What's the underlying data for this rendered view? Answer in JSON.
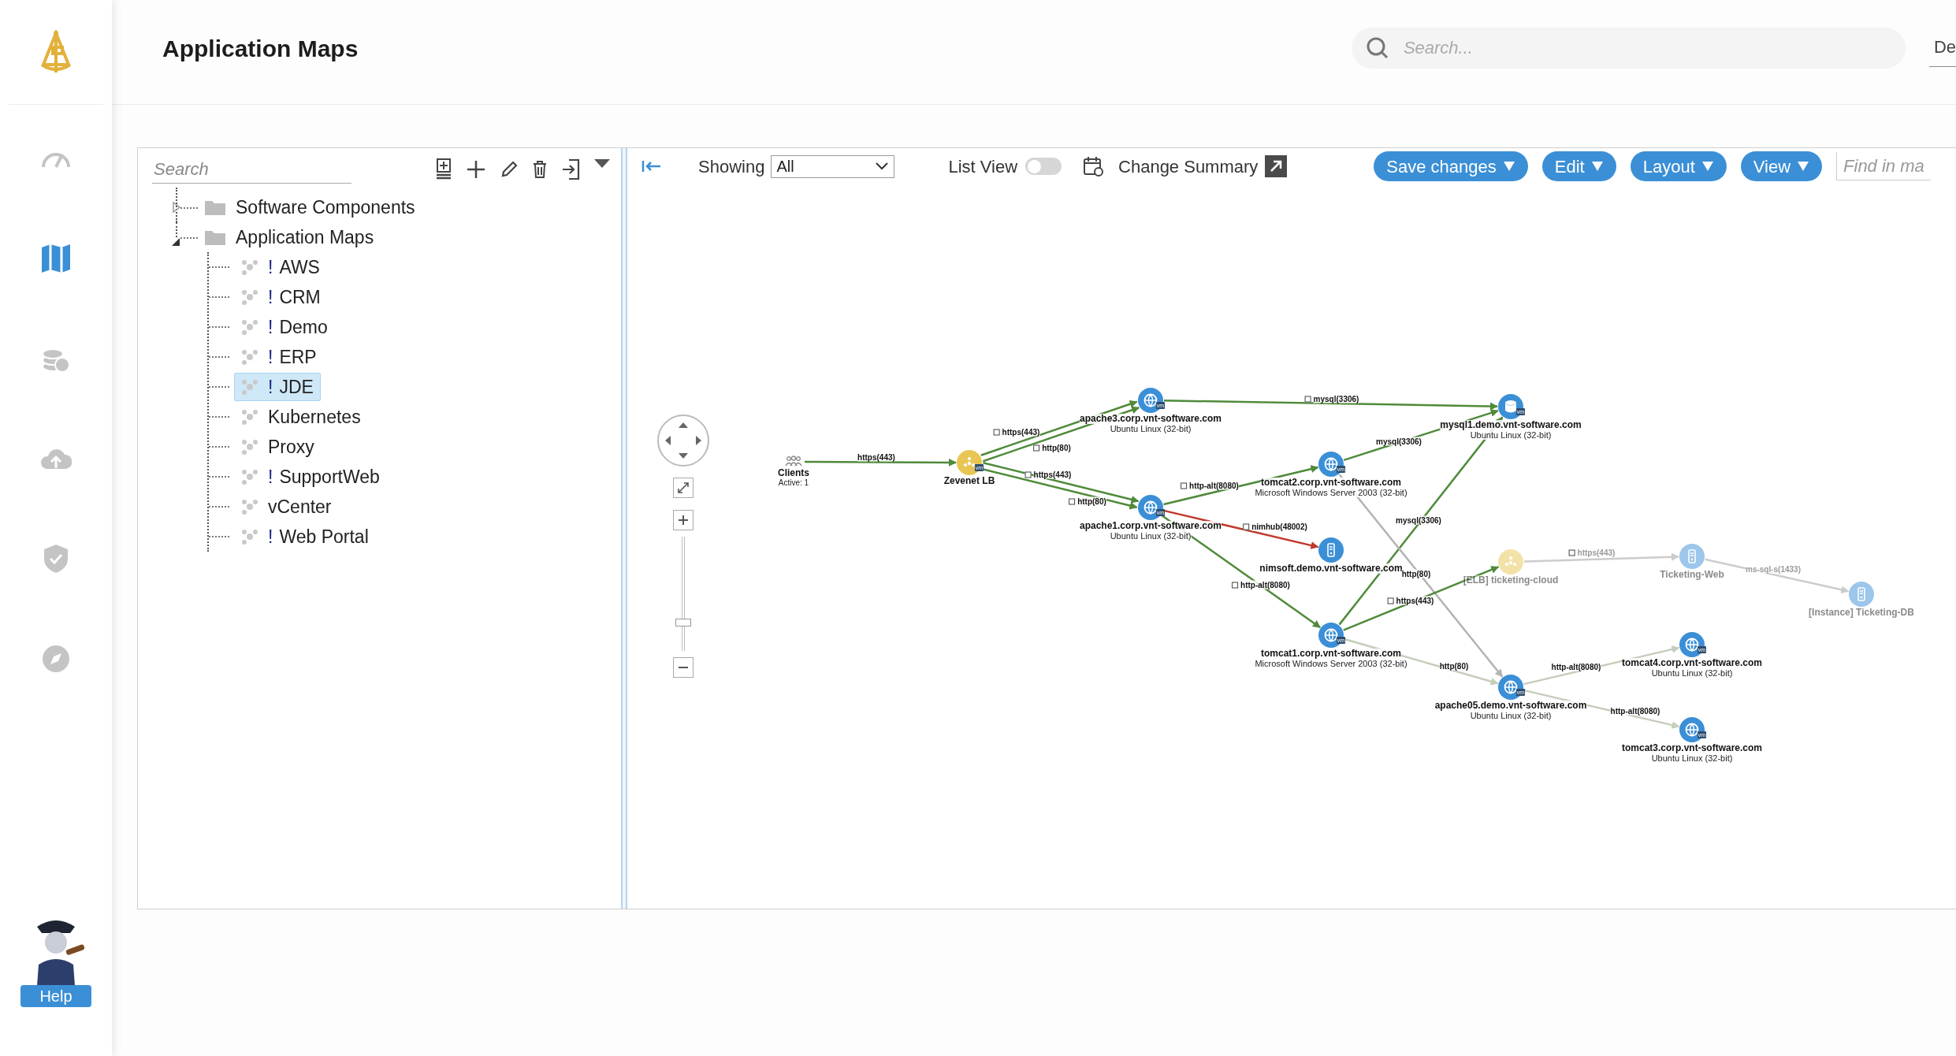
{
  "sidebar": {
    "items": [
      {
        "kind": "gauge",
        "selected": false
      },
      {
        "kind": "map",
        "selected": true
      },
      {
        "kind": "coins",
        "selected": false
      },
      {
        "kind": "cloud-upload",
        "selected": false
      },
      {
        "kind": "shield",
        "selected": false
      },
      {
        "kind": "compass",
        "selected": false
      }
    ],
    "help": "Help"
  },
  "header": {
    "title": "Application Maps",
    "search": {
      "placeholder": "Search..."
    },
    "menu": "De"
  },
  "tree_panel": {
    "search": {
      "placeholder": "Search"
    },
    "tree": [
      {
        "label": "Software Components",
        "expanded": false,
        "selected": false
      },
      {
        "label": "Application Maps",
        "expanded": true,
        "selected": false,
        "children": [
          {
            "marker": "!",
            "label": "AWS",
            "selected": false
          },
          {
            "marker": "!",
            "label": "CRM",
            "selected": false
          },
          {
            "marker": "!",
            "label": "Demo",
            "selected": false
          },
          {
            "marker": "!",
            "label": "ERP",
            "selected": false
          },
          {
            "marker": "!",
            "label": "JDE",
            "selected": true
          },
          {
            "label": "Kubernetes",
            "selected": false
          },
          {
            "label": "Proxy",
            "selected": false
          },
          {
            "marker": "!",
            "label": "SupportWeb",
            "selected": false
          },
          {
            "label": "vCenter",
            "selected": false
          },
          {
            "marker": "!",
            "label": "Web Portal",
            "selected": false
          }
        ]
      }
    ]
  },
  "map_toolbar": {
    "showing": {
      "label": "Showing",
      "value": "All"
    },
    "list_view": {
      "label": "List View",
      "on": false
    },
    "change_summary": "Change Summary",
    "buttons": [
      "Save changes",
      "Edit",
      "Layout",
      "View"
    ],
    "find": {
      "placeholder": "Find in ma"
    }
  },
  "map": {
    "zoom": {
      "level": 0.25
    },
    "nodes": [
      {
        "kind": "clients",
        "name": "Clients",
        "detail": "Active: 1",
        "dimmed": false
      },
      {
        "kind": "load-balancer",
        "name": "Zevenet LB",
        "badge": "vm",
        "dimmed": false
      },
      {
        "kind": "web",
        "name": "apache3.corp.vnt-software.com",
        "detail": "Ubuntu Linux (32-bit)",
        "badge": "vm",
        "dimmed": false
      },
      {
        "kind": "web",
        "name": "apache1.corp.vnt-software.com",
        "detail": "Ubuntu Linux (32-bit)",
        "badge": "vm",
        "dimmed": false
      },
      {
        "kind": "web",
        "name": "tomcat2.corp.vnt-software.com",
        "detail": "Microsoft Windows Server 2003 (32-bit)",
        "badge": "vm",
        "dimmed": false
      },
      {
        "kind": "server",
        "name": "nimsoft.demo.vnt-software.com",
        "dimmed": false
      },
      {
        "kind": "web",
        "name": "tomcat1.corp.vnt-software.com",
        "detail": "Microsoft Windows Server 2003 (32-bit)",
        "badge": "vm",
        "dimmed": false
      },
      {
        "kind": "database",
        "name": "mysql1.demo.vnt-software.com",
        "detail": "Ubuntu Linux (32-bit)",
        "badge": "vm",
        "dimmed": false
      },
      {
        "kind": "cloud-lb",
        "name": "[ELB] ticketing-cloud",
        "dimmed": true
      },
      {
        "kind": "web",
        "name": "apache05.demo.vnt-software.com",
        "detail": "Ubuntu Linux (32-bit)",
        "badge": "vm",
        "dimmed": false
      },
      {
        "kind": "server",
        "name": "Ticketing-Web",
        "dimmed": true
      },
      {
        "kind": "server",
        "name": "[Instance] Ticketing-DB",
        "dimmed": true
      },
      {
        "kind": "web",
        "name": "tomcat4.corp.vnt-software.com",
        "detail": "Ubuntu Linux (32-bit)",
        "badge": "vm",
        "dimmed": false
      },
      {
        "kind": "web",
        "name": "tomcat3.corp.vnt-software.com",
        "detail": "Ubuntu Linux (32-bit)",
        "badge": "vm",
        "dimmed": false
      }
    ],
    "edges": [
      {
        "label": "https(443)",
        "color": "#4f8a3a"
      },
      {
        "label": "https(443)",
        "color": "#4f8a3a",
        "checked": false
      },
      {
        "label": "http(80)",
        "color": "#4f8a3a",
        "checked": false
      },
      {
        "label": "https(443)",
        "color": "#4f8a3a",
        "checked": false
      },
      {
        "label": "http(80)",
        "color": "#4f8a3a",
        "checked": false
      },
      {
        "label": "mysql(3306)",
        "color": "#4f8a3a",
        "checked": false
      },
      {
        "label": "http-alt(8080)",
        "color": "#4f8a3a",
        "checked": false
      },
      {
        "label": "nimhub(48002)",
        "color": "#c0392b",
        "checked": false
      },
      {
        "label": "http-alt(8080)",
        "color": "#4f8a3a",
        "checked": false
      },
      {
        "label": "mysql(3306)",
        "color": "#4f8a3a"
      },
      {
        "label": "mysql(3306)",
        "color": "#4f8a3a"
      },
      {
        "label": "http(80)",
        "color": "#b3b3b3"
      },
      {
        "label": "https(443)",
        "color": "#4f8a3a",
        "checked": false
      },
      {
        "label": "http(80)",
        "color": "#c5cdbb"
      },
      {
        "label": "https(443)",
        "color": "#cccccc",
        "checked": false
      },
      {
        "label": "ms-sql-s(1433)",
        "color": "#cccccc"
      },
      {
        "label": "http-alt(8080)",
        "color": "#c5cdbb"
      },
      {
        "label": "http-alt(8080)",
        "color": "#c5cdbb"
      }
    ]
  }
}
